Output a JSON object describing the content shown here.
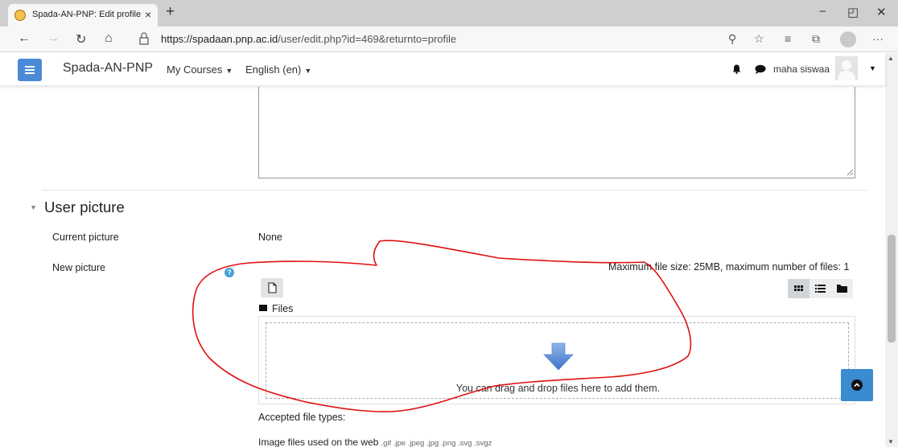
{
  "browser": {
    "tab_title": "Spada-AN-PNP: Edit profile",
    "tab_close": "×",
    "new_tab": "+",
    "url_domain": "https://spadaan.pnp.ac.id",
    "url_path": "/user/edit.php?id=469&returnto=profile",
    "controls": {
      "minimize": "−",
      "restore": "◰",
      "close": "✕"
    },
    "more": "···"
  },
  "navbar": {
    "brand": "Spada-AN-PNP",
    "menu_courses": "My Courses",
    "menu_language": "English (en)",
    "username": "maha siswaa"
  },
  "section": {
    "title": "User picture",
    "current_picture_label": "Current picture",
    "current_picture_value": "None",
    "new_picture_label": "New picture",
    "help_glyph": "?",
    "max_info": "Maximum file size: 25MB, maximum number of files: 1",
    "files_label": "Files",
    "drop_text": "You can drag and drop files here to add them.",
    "accepted_label": "Accepted file types:",
    "image_types_label": "Image files used on the web",
    "image_types_ext": ".gif .jpe .jpeg .jpg .png .svg .svgz"
  },
  "colors": {
    "accent_blue": "#4a8ad6",
    "back_to_top": "#3a8bd0",
    "annotation_red": "#e01010"
  }
}
